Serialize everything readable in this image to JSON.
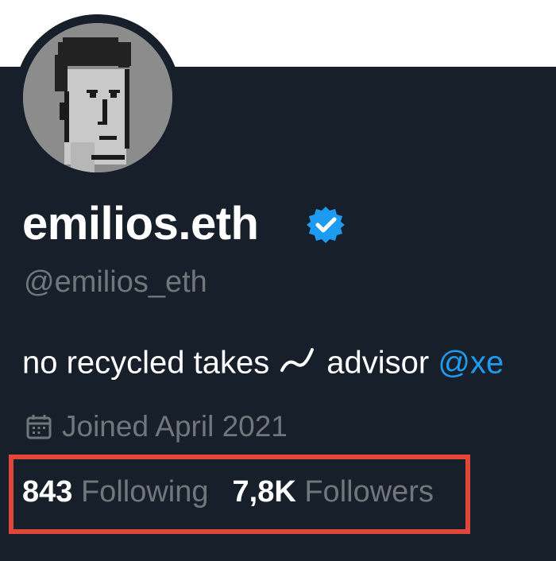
{
  "profile": {
    "display_name": "emilios.eth",
    "handle": "@emilios_eth",
    "bio_prefix": "no recycled takes",
    "bio_middle": "advisor",
    "bio_mention": "@xe",
    "joined": "Joined April 2021",
    "following_count": "843",
    "following_label": "Following",
    "followers_count": "7,8K",
    "followers_label": "Followers",
    "verified": true
  },
  "icons": {
    "verified": "verified-badge-icon",
    "calendar": "calendar-icon",
    "bio_emoji": "tilde-squiggle-icon"
  },
  "colors": {
    "background": "#17202a",
    "banner": "#ffffff",
    "verified": "#1d9bf0",
    "mention": "#1d9bf0",
    "secondary_text": "#71767b",
    "highlight_box": "#e0473a"
  }
}
